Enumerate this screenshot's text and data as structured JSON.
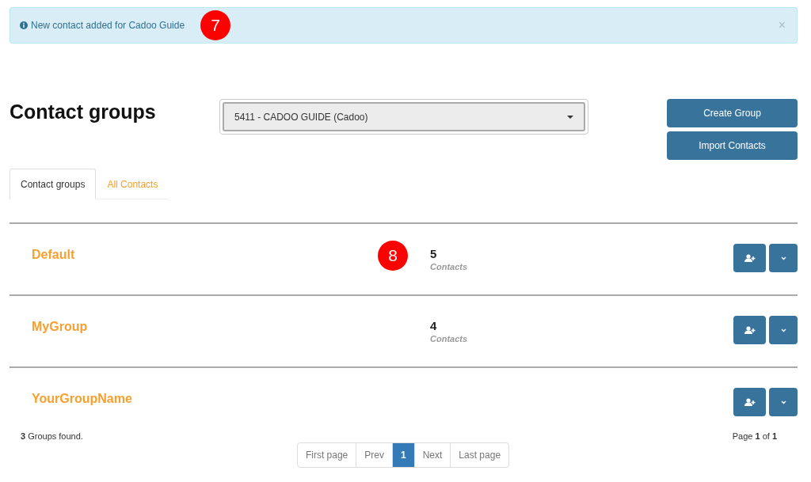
{
  "alert": {
    "message": "New contact added for Cadoo Guide",
    "callout": "7",
    "close": "×"
  },
  "page_title": "Contact groups",
  "account_select": {
    "value": "5411 - CADOO GUIDE (Cadoo)"
  },
  "actions": [
    "Create Group",
    "Import Contacts"
  ],
  "tabs": [
    {
      "label": "Contact groups",
      "selected": true
    },
    {
      "label": "All Contacts",
      "selected": false
    }
  ],
  "groups": [
    {
      "name": "Default",
      "count": "5",
      "count_label": "Contacts",
      "callout": "8"
    },
    {
      "name": "MyGroup",
      "count": "4",
      "count_label": "Contacts"
    },
    {
      "name": "YourGroupName"
    }
  ],
  "footer": {
    "found": "**3** Groups found.",
    "page": "Page **1** of **1**"
  },
  "pagination": [
    {
      "label": "First page",
      "selected": false
    },
    {
      "label": "Prev",
      "selected": false
    },
    {
      "label": "1",
      "selected": true
    },
    {
      "label": "Next",
      "selected": false
    },
    {
      "label": "Last page",
      "selected": false
    }
  ]
}
